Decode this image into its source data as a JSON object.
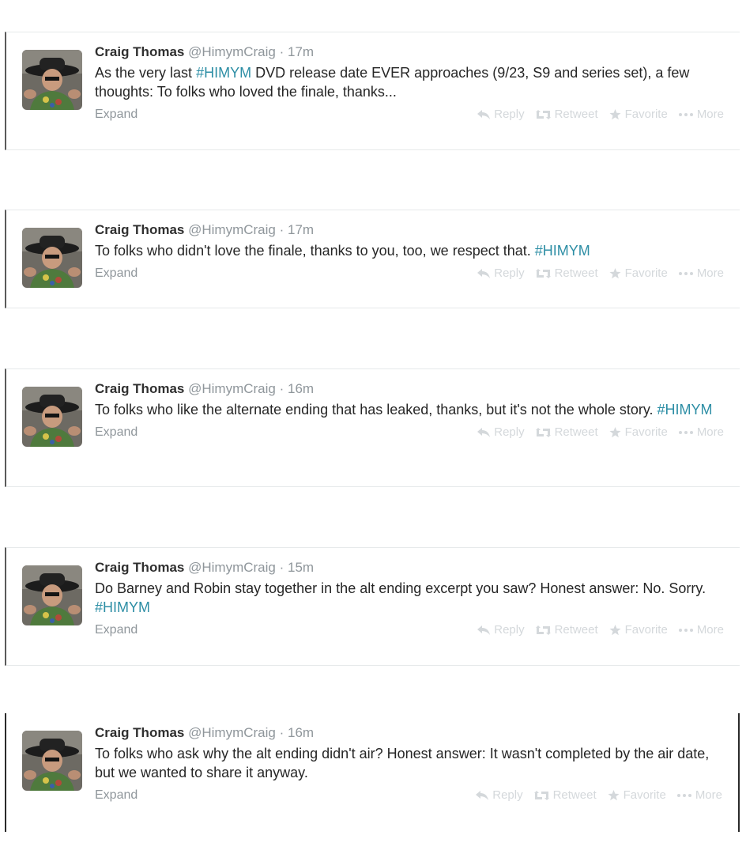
{
  "tweets": [
    {
      "name": "Craig Thomas",
      "handle": "@HimymCraig",
      "separator": "·",
      "time": "17m",
      "text": [
        {
          "t": "As the very last ",
          "tag": false
        },
        {
          "t": "#HIMYM",
          "tag": true
        },
        {
          "t": " DVD release date EVER approaches (9/23, S9 and series set), a few thoughts: To folks who loved the finale, thanks...",
          "tag": false
        }
      ],
      "expand": "Expand"
    },
    {
      "name": "Craig Thomas",
      "handle": "@HimymCraig",
      "separator": "·",
      "time": "17m",
      "text": [
        {
          "t": "To folks who didn't love the finale, thanks to you, too, we respect that. ",
          "tag": false
        },
        {
          "t": "#HIMYM",
          "tag": true
        }
      ],
      "expand": "Expand"
    },
    {
      "name": "Craig Thomas",
      "handle": "@HimymCraig",
      "separator": "·",
      "time": "16m",
      "text": [
        {
          "t": "To folks who like the alternate ending that has leaked, thanks, but it's not the whole story. ",
          "tag": false
        },
        {
          "t": "#HIMYM",
          "tag": true
        }
      ],
      "expand": "Expand"
    },
    {
      "name": "Craig Thomas",
      "handle": "@HimymCraig",
      "separator": "·",
      "time": "15m",
      "text": [
        {
          "t": "Do Barney and Robin stay together in the alt ending excerpt you saw?  Honest answer:  No.  Sorry.  ",
          "tag": false
        },
        {
          "t": "#HIMYM",
          "tag": true
        }
      ],
      "expand": "Expand"
    },
    {
      "name": "Craig Thomas",
      "handle": "@HimymCraig",
      "separator": "·",
      "time": "16m",
      "text": [
        {
          "t": "To folks who ask why the alt ending didn't air?  Honest answer: It wasn't completed by the air date, but we wanted to share it anyway.",
          "tag": false
        }
      ],
      "expand": "Expand"
    }
  ],
  "actions": {
    "reply": "Reply",
    "retweet": "Retweet",
    "favorite": "Favorite",
    "more": "More"
  },
  "colors": {
    "hashtag": "#2d8ea5",
    "muted": "#8f969b",
    "action": "#d4d8db",
    "divider": "#e6e9ea"
  },
  "icons": [
    "reply-icon",
    "retweet-icon",
    "favorite-icon",
    "more-icon"
  ]
}
